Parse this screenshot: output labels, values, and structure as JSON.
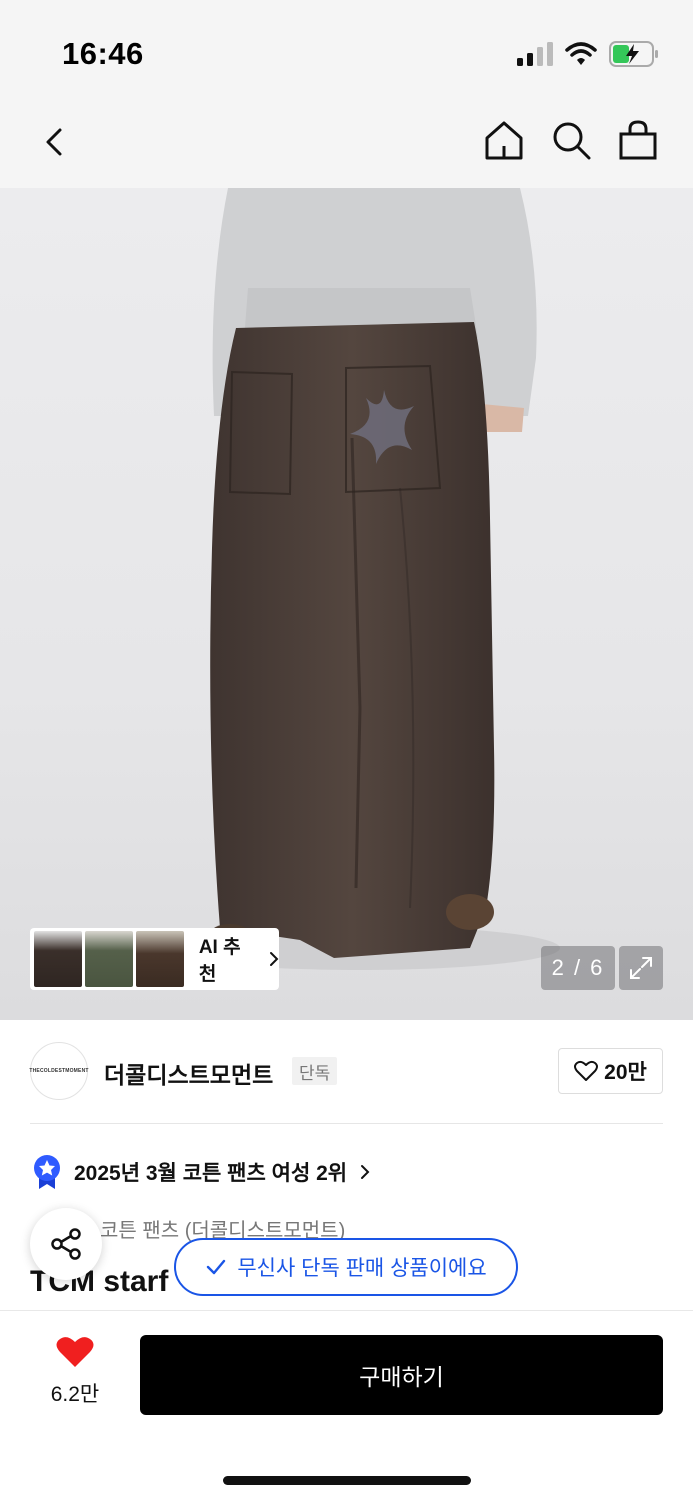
{
  "status_bar": {
    "time": "16:46"
  },
  "nav": {
    "back_icon": "chevron-left-icon",
    "home_icon": "home-icon",
    "search_icon": "search-icon",
    "cart_icon": "shopping-bag-icon"
  },
  "gallery": {
    "ai_recommend_label": "AI 추천",
    "counter": "2 / 6",
    "thumb_colors": [
      "#3a2f2a",
      "#55604a",
      "#4a372c"
    ],
    "product_color": "#4a3d38"
  },
  "brand": {
    "logo_text": "THECOLDESTMOMENT",
    "name": "더콜디스트모먼트",
    "badge": "단독",
    "like_count": "20만"
  },
  "ranking": {
    "text": "2025년 3월 코튼 팬츠 여성 2위"
  },
  "product": {
    "category": "코튼 팬츠 (더콜디스트모먼트)",
    "title": "TCM starf"
  },
  "toast": {
    "text": "무신사 단독 판매 상품이에요"
  },
  "bottom_bar": {
    "heart_count": "6.2만",
    "buy_label": "구매하기"
  },
  "colors": {
    "accent_blue": "#1a55e6",
    "heart_red": "#f01f1f",
    "buy_button": "#000000"
  }
}
